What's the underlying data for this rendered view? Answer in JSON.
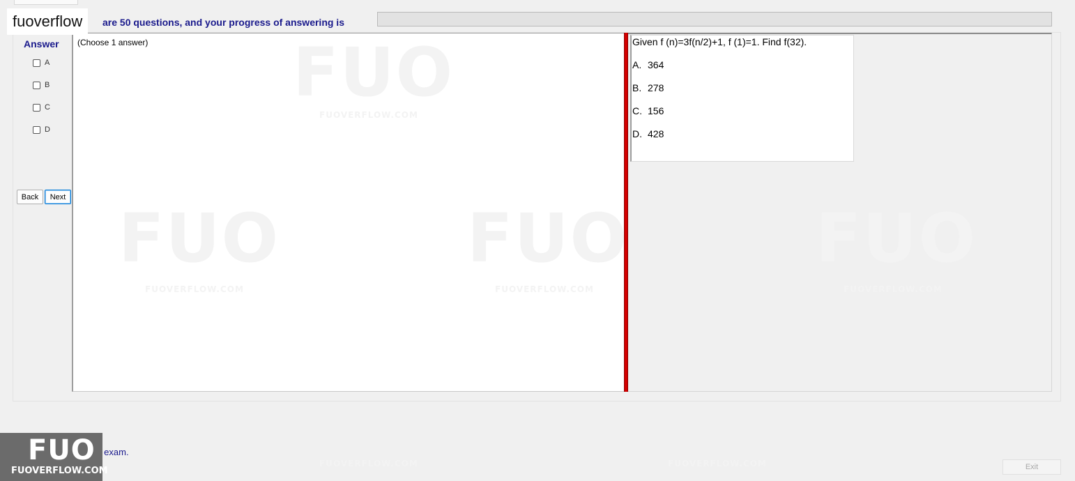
{
  "header": {
    "watermark_label": "fuoverflow",
    "progress_text": "are 50 questions, and your progress of answering is",
    "progress_value": 0
  },
  "answer_panel": {
    "title": "Answer",
    "options": [
      "A",
      "B",
      "C",
      "D"
    ]
  },
  "nav": {
    "back_label": "Back",
    "next_label": "Next"
  },
  "question_area": {
    "instruction": "(Choose 1 answer)"
  },
  "question": {
    "text": "Given f (n)=3f(n/2)+1, f (1)=1. Find f(32).",
    "options": [
      {
        "letter": "A.",
        "value": "364"
      },
      {
        "letter": "B.",
        "value": "278"
      },
      {
        "letter": "C.",
        "value": "156"
      },
      {
        "letter": "D.",
        "value": "428"
      }
    ]
  },
  "footer": {
    "finish_text": "want to finish the exam.",
    "exit_label": "Exit"
  },
  "logo": {
    "mark": "FUO",
    "text": "FUOVERFLOW.COM"
  },
  "watermarks": {
    "big": "FUO",
    "small": "FUOVERFLOW.COM"
  },
  "colors": {
    "accent_text": "#1a1a8c",
    "divider": "#d40000",
    "progress_fill": "#06b025"
  }
}
